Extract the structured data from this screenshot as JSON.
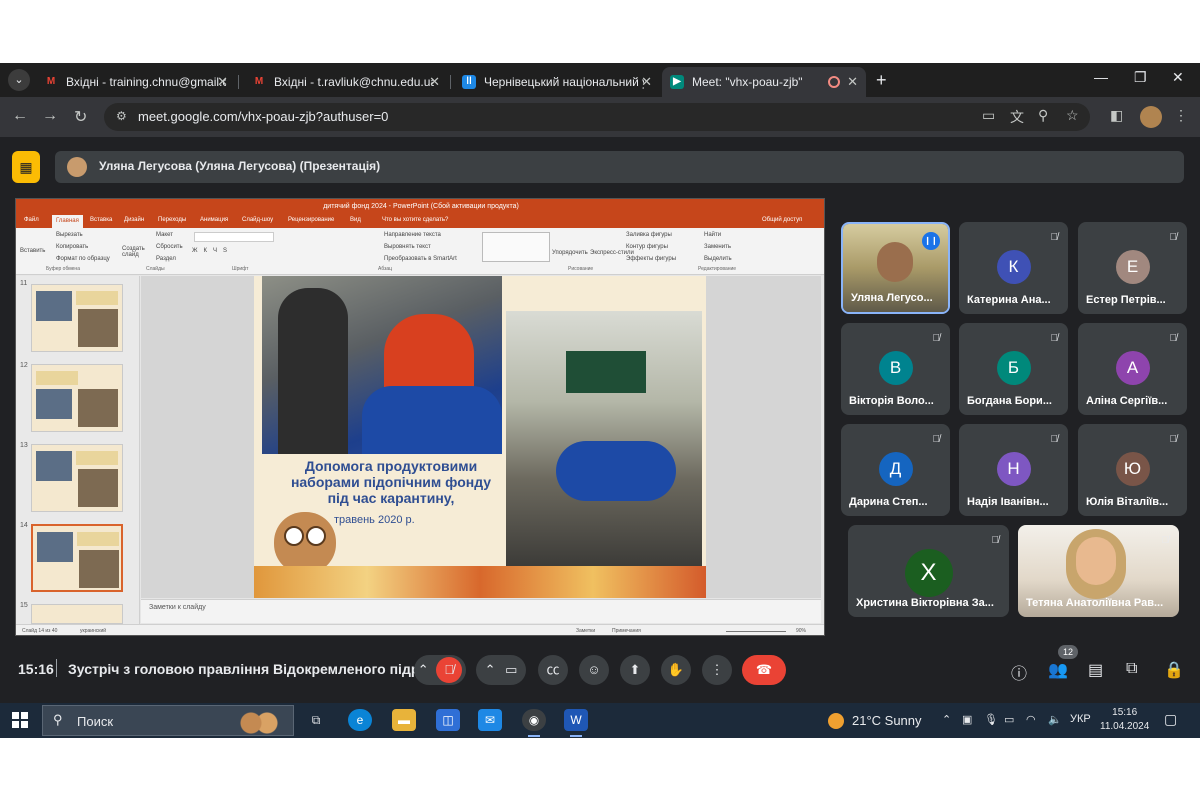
{
  "browser": {
    "tabs": [
      {
        "icon": "gmail-icon",
        "title": "Вхідні - training.chnu@gmail.com"
      },
      {
        "icon": "gmail-icon",
        "title": "Вхідні - t.ravliuk@chnu.edu.ua"
      },
      {
        "icon": "moodle-icon",
        "title": "Чернівецький національний університет"
      },
      {
        "icon": "meet-icon",
        "title": "Meet: \"vhx-poau-zjb\""
      }
    ],
    "url": "meet.google.com/vhx-poau-zjb?authuser=0"
  },
  "meet": {
    "presenter_label": "Уляна Легусова (Уляна Легусова) (Презентація)",
    "time": "15:16",
    "meeting_title": "Зустріч з головою правління Відокремленого підр...",
    "participants_count": "12",
    "participants": [
      {
        "initial": "",
        "name": "Уляна Легусо...",
        "color": "",
        "video": true
      },
      {
        "initial": "К",
        "name": "Катерина Ана...",
        "color": "#3f51b5"
      },
      {
        "initial": "Е",
        "name": "Естер Петрів...",
        "color": "#a1887f"
      },
      {
        "initial": "В",
        "name": "Вікторія Воло...",
        "color": "#00838f"
      },
      {
        "initial": "Б",
        "name": "Богдана Бори...",
        "color": "#00897b"
      },
      {
        "initial": "А",
        "name": "Аліна Сергіїв...",
        "color": "#8e44ad"
      },
      {
        "initial": "Д",
        "name": "Дарина Степ...",
        "color": "#1565c0"
      },
      {
        "initial": "Н",
        "name": "Надія Іванівн...",
        "color": "#7e57c2"
      },
      {
        "initial": "Ю",
        "name": "Юлія Віталіїв...",
        "color": "#795548"
      },
      {
        "initial": "Х",
        "name": "Христина Вікторівна За...",
        "color": "#1b5e20"
      },
      {
        "initial": "",
        "name": "Тетяна Анатоліївна Рав...",
        "color": "",
        "video": true
      }
    ]
  },
  "ppt": {
    "window_title": "дитячий фонд 2024 - PowerPoint (Сбой активации продукта)",
    "menu": [
      "Файл",
      "Главная",
      "Вставка",
      "Дизайн",
      "Переходы",
      "Анимация",
      "Слайд-шоу",
      "Рецензирование",
      "Вид",
      "Что вы хотите сделать?"
    ],
    "share": "Общий доступ",
    "ribbon": {
      "paste": "Вставить",
      "cut": "Вырезать",
      "copy": "Копировать",
      "format_painter": "Формат по образцу",
      "new_slide": "Создать слайд",
      "layout": "Макет",
      "reset": "Сбросить",
      "section": "Раздел",
      "text_direction": "Направление текста",
      "align_text": "Выровнять текст",
      "smartart": "Преобразовать в SmartArt",
      "arrange": "Упорядочить",
      "quick_styles": "Экспресс-стили",
      "shape_fill": "Заливка фигуры",
      "shape_outline": "Контур фигуры",
      "shape_effects": "Эффекты фигуры",
      "find": "Найти",
      "replace": "Заменить",
      "select": "Выделить",
      "groups": [
        "Буфер обмена",
        "Слайды",
        "Шрифт",
        "Абзац",
        "Рисование",
        "Редактирование"
      ]
    },
    "thumbnails": [
      "11",
      "12",
      "13",
      "14",
      "15"
    ],
    "slide_title": "Допомога продуктовими наборами підопічним фонду під час карантину,",
    "slide_date": "травень 2020 р.",
    "notes": "Заметки к слайду",
    "status_left": "Слайд 14 из 40",
    "status_lang": "украинский",
    "status_notes": "Заметки",
    "status_comments": "Примечания",
    "zoom": "90%"
  },
  "taskbar": {
    "search": "Поиск",
    "weather": "21°C  Sunny",
    "lang": "УКР",
    "time": "15:16",
    "date": "11.04.2024"
  }
}
